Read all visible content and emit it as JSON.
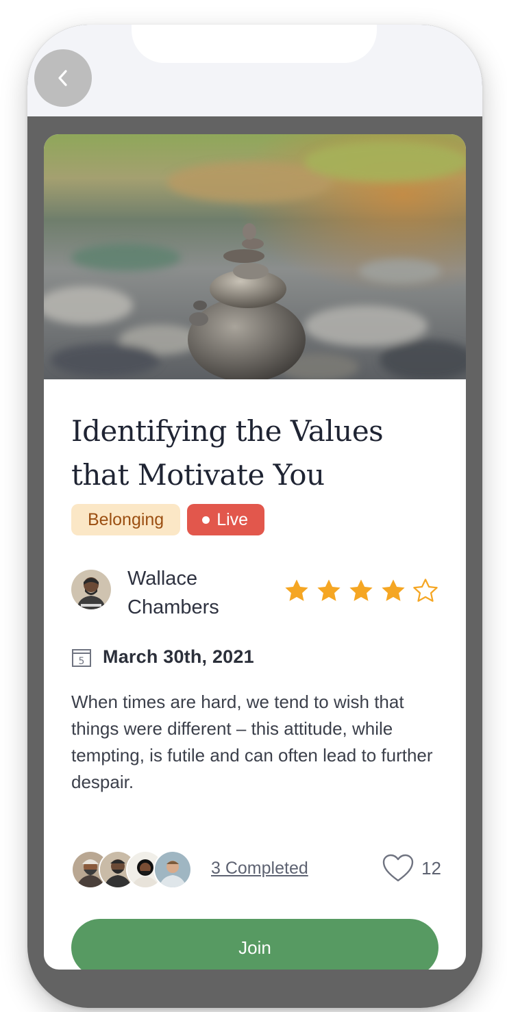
{
  "header": {
    "back_icon": "chevron-left-icon"
  },
  "card": {
    "title": "Identifying the Values that Motivate You",
    "tags": {
      "category": "Belonging",
      "live": "Live"
    },
    "author": {
      "name": "Wallace Chambers"
    },
    "rating": {
      "value": 4,
      "max": 5
    },
    "date": "March 30th, 2021",
    "calendar_day": "5",
    "description": "When times are hard, we tend to wish that things were different – this attitude, while tempting, is futile and can often lead to further despair.",
    "completed_label": "3 Completed",
    "likes": "12",
    "join_label": "Join"
  },
  "colors": {
    "accent_green": "#579a62",
    "live_red": "#e2574c",
    "tag_bg": "#fbe7c6",
    "tag_text": "#9b4f12",
    "star": "#f5a623",
    "frame": "#636363"
  }
}
